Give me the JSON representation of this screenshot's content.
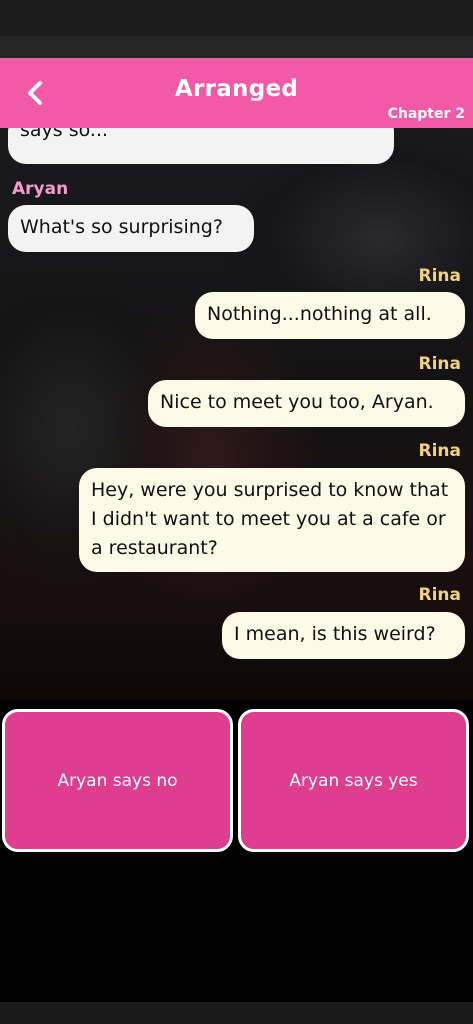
{
  "header": {
    "title": "Arranged",
    "chapter": "Chapter 2",
    "back_icon": "chevron-left-icon"
  },
  "colors": {
    "header_bg": "#f25aa8",
    "choice_bg": "#de3d90",
    "bubble_bg": "#fff9e8",
    "aryan_name": "#f59ad0",
    "rina_name": "#f3d37a"
  },
  "chat": {
    "partial_message": "says so...",
    "messages": [
      {
        "sender": "Aryan",
        "text": "What's so surprising?"
      },
      {
        "sender": "Rina",
        "text": "Nothing...nothing at all."
      },
      {
        "sender": "Rina",
        "text": "Nice to meet you too, Aryan."
      },
      {
        "sender": "Rina",
        "text": "Hey, were you surprised to know that I didn't want to meet you at a cafe or a restaurant?"
      },
      {
        "sender": "Rina",
        "text": "I mean, is this weird?"
      }
    ]
  },
  "choices": {
    "no_label": "Aryan says no",
    "yes_label": "Aryan says yes"
  }
}
